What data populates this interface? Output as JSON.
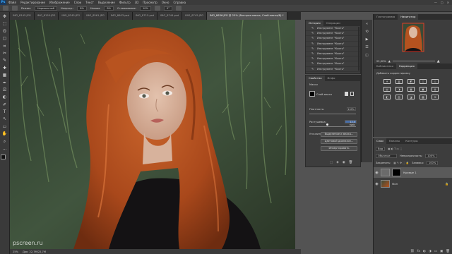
{
  "menubar": {
    "logo": "Ps",
    "items": [
      "Файл",
      "Редактирование",
      "Изображение",
      "Слои",
      "Текст",
      "Выделение",
      "Фильтр",
      "3D",
      "Просмотр",
      "Окно",
      "Справка"
    ],
    "window_controls": [
      "—",
      "□",
      "✕"
    ]
  },
  "options": {
    "mode_label": "Режим:",
    "mode_value": "Нормальный",
    "opacity_label": "Непрозр.:",
    "opacity_value": "8%",
    "pressure_label": "Нажим:",
    "pressure_value": "8%",
    "smoothing_label": "Сглаживание:",
    "smoothing_value": "10%",
    "angle_value": "0°"
  },
  "tabs": [
    {
      "label": "IMG_8145.JPG",
      "active": false
    },
    {
      "label": "IMG_8155.JPG",
      "active": false
    },
    {
      "label": "IMG_8245.JPG",
      "active": false
    },
    {
      "label": "IMG_8561.JPG",
      "active": false
    },
    {
      "label": "IMG_8603.psd",
      "active": false
    },
    {
      "label": "IMG_8715.psd",
      "active": false
    },
    {
      "label": "IMG_8744.psd",
      "active": false
    },
    {
      "label": "IMG_8745.JPG",
      "active": false
    },
    {
      "label": "IMG_8636.JPG @ 25% (Быстрая маска, Слой-маска/8) *",
      "active": true
    }
  ],
  "toolbar": [
    "✥",
    "⬚",
    "ʘ",
    "▢",
    "⌗",
    "✂",
    "✎",
    "✚",
    "▦",
    "✒",
    "⎚",
    "◐",
    "✐",
    "T",
    "↖",
    "▭",
    "✋",
    "⌕",
    "…"
  ],
  "status": {
    "zoom": "25%",
    "doc": "Док: 22,7M/22,7M"
  },
  "watermark": "pscreen.ru",
  "history": {
    "tabs": [
      "История",
      "Операции"
    ],
    "tool_name": "Инструмент \"Кисть\"",
    "row_count": 9
  },
  "properties": {
    "tabs": [
      "Свойства",
      "Инфо"
    ],
    "section": "Маски",
    "layer_mask": "Слой-маска",
    "density_label": "Плотность:",
    "density_value": "100%",
    "feather_label": "Растушевка:",
    "feather_value": "12,0 пикс",
    "refine_label": "Уточнить:",
    "btn_select_mask": "Выделение и маска...",
    "btn_color_range": "Цветовой диапазон...",
    "btn_invert": "Инвертировать"
  },
  "navigator": {
    "tabs": [
      "Гистограмма",
      "Навигатор"
    ],
    "zoom": "25,00%"
  },
  "corrections": {
    "tabs": [
      "Библиотеки",
      "Коррекция"
    ],
    "subtitle": "Добавить корректировку",
    "icons": [
      "☀",
      "▥",
      "◩",
      "▽",
      "◇",
      "▤",
      "◑",
      "▦",
      "▣",
      "◍",
      "◧",
      "▨",
      "◪",
      "▩",
      "⊞"
    ]
  },
  "layers": {
    "tabs": [
      "Слои",
      "Каналы",
      "Контуры"
    ],
    "filter_label": "Вид",
    "blend_mode": "Обычные",
    "opacity_label": "Непрозрачность:",
    "opacity_value": "100%",
    "lock_label": "Закрепить:",
    "fill_label": "Заливка:",
    "fill_value": "100%",
    "items": [
      {
        "name": "Кривые 1",
        "selected": true
      },
      {
        "name": "Фон",
        "selected": false
      }
    ],
    "bottom_icons": [
      "⛓",
      "fx",
      "◐",
      "◑",
      "▭",
      "▣",
      "🗑"
    ]
  },
  "colors": {
    "accent": "#31a8ff",
    "hair": "#b5521f",
    "foliage": "#4b6a3f"
  }
}
